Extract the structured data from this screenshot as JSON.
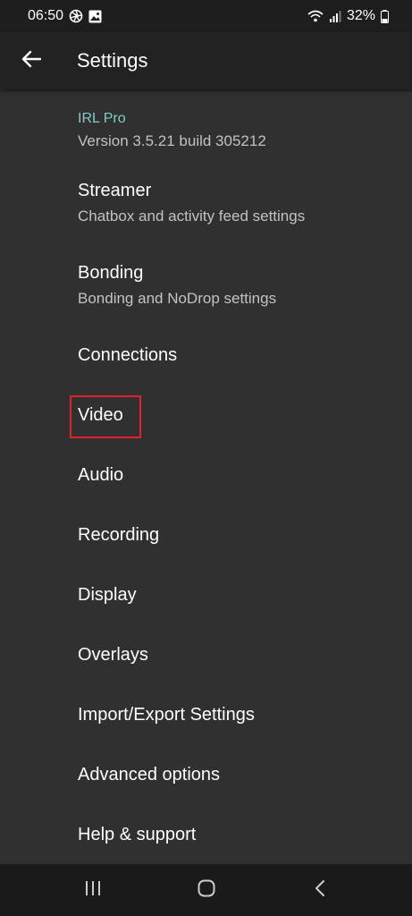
{
  "status_bar": {
    "time": "06:50",
    "battery": "32%",
    "icons": [
      "aperture-icon",
      "image-icon",
      "wifi-icon",
      "signal-icon",
      "battery-icon"
    ]
  },
  "app_bar": {
    "title": "Settings",
    "back_icon": "arrow-back-icon"
  },
  "app_info": {
    "name": "IRL Pro",
    "version": "Version 3.5.21 build 305212"
  },
  "items": [
    {
      "title": "Streamer",
      "subtitle": "Chatbox and activity feed settings"
    },
    {
      "title": "Bonding",
      "subtitle": "Bonding and NoDrop settings"
    },
    {
      "title": "Connections"
    },
    {
      "title": "Video"
    },
    {
      "title": "Audio"
    },
    {
      "title": "Recording"
    },
    {
      "title": "Display"
    },
    {
      "title": "Overlays"
    },
    {
      "title": "Import/Export Settings"
    },
    {
      "title": "Advanced options"
    },
    {
      "title": "Help & support"
    }
  ],
  "colors": {
    "accent": "#80cbc4",
    "highlight": "#e0202a",
    "background": "#303030",
    "app_bar": "#222222"
  },
  "nav_bar": {
    "buttons": [
      "recent-apps-icon",
      "home-icon",
      "back-nav-icon"
    ]
  }
}
